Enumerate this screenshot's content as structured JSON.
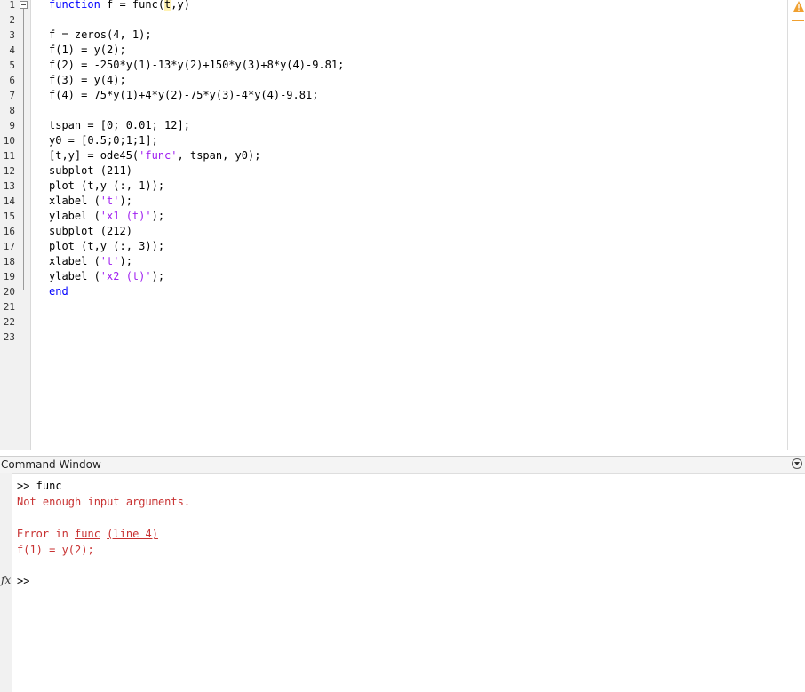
{
  "editor": {
    "line_numbers": [
      "1",
      "2",
      "3",
      "4",
      "5",
      "6",
      "7",
      "8",
      "9",
      "10",
      "11",
      "12",
      "13",
      "14",
      "15",
      "16",
      "17",
      "18",
      "19",
      "20",
      "21",
      "22",
      "23"
    ],
    "code": {
      "l1_kw": "function",
      "l1_pre": " f = func(",
      "l1_hl": "t",
      "l1_post": ",y)",
      "l3": "f = zeros(4, 1);",
      "l4": "f(1) = y(2);",
      "l5": "f(2) = -250*y(1)-13*y(2)+150*y(3)+8*y(4)-9.81;",
      "l6": "f(3) = y(4);",
      "l7": "f(4) = 75*y(1)+4*y(2)-75*y(3)-4*y(4)-9.81;",
      "l9": "tspan = [0; 0.01; 12];",
      "l10": "y0 = [0.5;0;1;1];",
      "l11_pre": "[t,y] = ode45(",
      "l11_str": "'func'",
      "l11_post": ", tspan, y0);",
      "l12": "subplot (211)",
      "l13": "plot (t,y (:, 1));",
      "l14_pre": "xlabel (",
      "l14_str": "'t'",
      "l14_post": ");",
      "l15_pre": "ylabel (",
      "l15_str": "'x1 (t)'",
      "l15_post": ");",
      "l16": "subplot (212)",
      "l17": "plot (t,y (:, 3));",
      "l18_pre": "xlabel (",
      "l18_str": "'t'",
      "l18_post": ");",
      "l19_pre": "ylabel (",
      "l19_str": "'x2 (t)'",
      "l19_post": ");",
      "l20_kw": "end"
    },
    "warning_icon": "warning-triangle-icon",
    "colors": {
      "keyword": "#0000ff",
      "string": "#a020f0",
      "error": "#c83232",
      "warning": "#f0a030"
    }
  },
  "command_window": {
    "title": "Command Window",
    "menu_icon": "chevron-down-circle-icon",
    "input_line": ">> func",
    "error_msg": "Not enough input arguments.",
    "error_in_pre": "Error in ",
    "error_in_func": "func",
    "error_in_line": "(line 4)",
    "error_code": "f(1) = y(2);",
    "fx_label": "fx",
    "prompt": ">>"
  }
}
